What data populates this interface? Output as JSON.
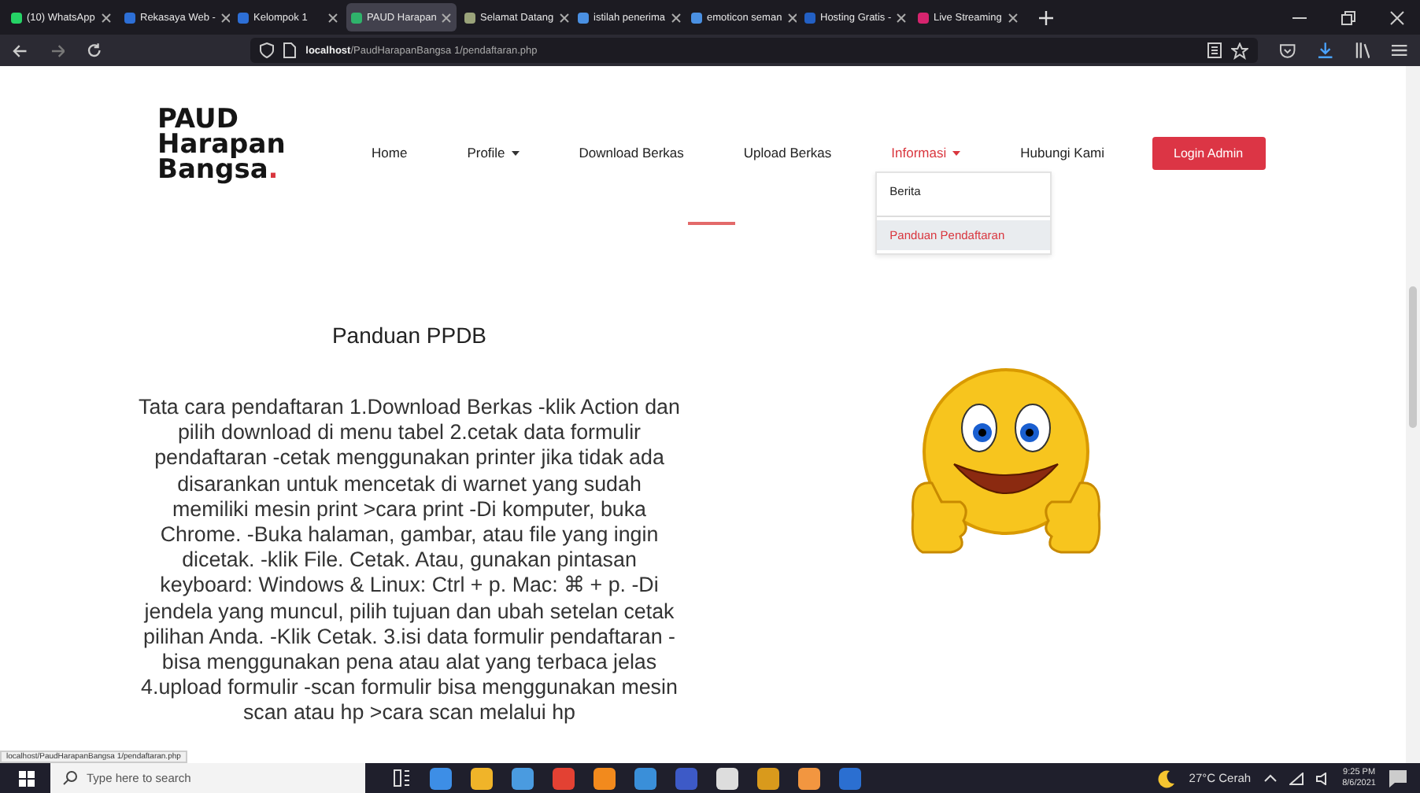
{
  "browser": {
    "tabs": [
      {
        "title": "(10) WhatsApp",
        "selected": false,
        "color": "#25d366"
      },
      {
        "title": "Rekasaya Web -",
        "selected": false,
        "color": "#2d6fd6"
      },
      {
        "title": "Kelompok 1",
        "selected": false,
        "color": "#2d6fd6"
      },
      {
        "title": "PAUD Harapan",
        "selected": true,
        "color": "#2fb36b"
      },
      {
        "title": "Selamat Datang",
        "selected": false,
        "color": "#9aa37a"
      },
      {
        "title": "istilah penerima",
        "selected": false,
        "color": "#4a90e2"
      },
      {
        "title": "emoticon seman",
        "selected": false,
        "color": "#4a90e2"
      },
      {
        "title": "Hosting Gratis -",
        "selected": false,
        "color": "#2360c4"
      },
      {
        "title": "Live Streaming",
        "selected": false,
        "color": "#d6246e"
      }
    ],
    "url_host": "localhost",
    "url_path": "/PaudHarapanBangsa 1/pendaftaran.php"
  },
  "site": {
    "logo": {
      "lines": [
        "PAUD",
        "Harapan",
        "Bangsa"
      ],
      "dot": "."
    },
    "nav": [
      {
        "label": "Home",
        "kind": "link",
        "selected": false
      },
      {
        "label": "Profile",
        "kind": "dropdown",
        "selected": false
      },
      {
        "label": "Download Berkas",
        "kind": "link",
        "selected": false
      },
      {
        "label": "Upload Berkas",
        "kind": "link",
        "selected": false
      },
      {
        "label": "Informasi",
        "kind": "dropdown",
        "selected": true,
        "expanded": true,
        "items": [
          {
            "label": "Berita",
            "selected": false
          },
          {
            "label": "Panduan Pendaftaran",
            "selected": true
          }
        ]
      },
      {
        "label": "Hubungi Kami",
        "kind": "link",
        "selected": false
      },
      {
        "label": "Login Admin",
        "kind": "button"
      }
    ],
    "heading": "Panduan PPDB",
    "paragraph": "Tata cara pendaftaran 1.Download Berkas -klik Action dan pilih download di menu tabel 2.cetak data formulir pendaftaran -cetak menggunakan printer jika tidak ada disarankan untuk mencetak di warnet yang sudah memiliki mesin print >cara print -Di komputer, buka Chrome. -Buka halaman, gambar, atau file yang ingin dicetak. -klik File. Cetak. Atau, gunakan pintasan keyboard: Windows & Linux: Ctrl + p. Mac: ⌘ + p. -Di jendela yang muncul, pilih tujuan dan ubah setelan cetak pilihan Anda. -Klik Cetak. 3.isi data formulir pendaftaran -bisa menggunakan pena atau alat yang terbaca jelas 4.upload formulir -scan formulir bisa menggunakan mesin scan atau hp >cara scan melalui hp"
  },
  "status_url": "localhost/PaudHarapanBangsa 1/pendaftaran.php",
  "taskbar": {
    "search_placeholder": "Type here to search",
    "weather": "27°C Cerah",
    "time": "9:25 PM",
    "date": "8/6/2021"
  }
}
